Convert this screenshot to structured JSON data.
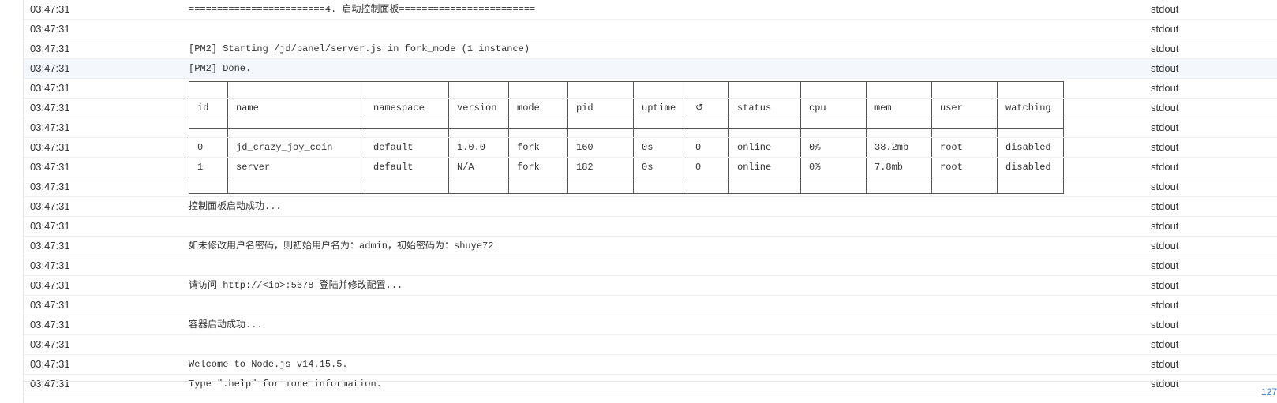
{
  "log": {
    "rows": [
      {
        "time": "03:47:31",
        "message": "========================4. 启动控制面板========================",
        "stream": "stdout"
      },
      {
        "time": "03:47:31",
        "message": "",
        "stream": "stdout"
      },
      {
        "time": "03:47:31",
        "message": "[PM2] Starting /jd/panel/server.js in fork_mode (1 instance)",
        "stream": "stdout"
      },
      {
        "time": "03:47:31",
        "message": "[PM2] Done.",
        "stream": "stdout"
      },
      {
        "time": "03:47:31",
        "kind": "border-top",
        "stream": "stdout"
      },
      {
        "time": "03:47:31",
        "kind": "header",
        "stream": "stdout"
      },
      {
        "time": "03:47:31",
        "kind": "border-mid",
        "stream": "stdout"
      },
      {
        "time": "03:47:31",
        "kind": "data",
        "cells": [
          "0",
          "jd_crazy_joy_coin",
          "default",
          "1.0.0",
          "fork",
          "160",
          "0s",
          "0",
          "online",
          "0%",
          "38.2mb",
          "root",
          "disabled"
        ],
        "stream": "stdout"
      },
      {
        "time": "03:47:31",
        "kind": "data",
        "cells": [
          "1",
          "server",
          "default",
          "N/A",
          "fork",
          "182",
          "0s",
          "0",
          "online",
          "0%",
          "7.8mb",
          "root",
          "disabled"
        ],
        "stream": "stdout"
      },
      {
        "time": "03:47:31",
        "kind": "border-bottom",
        "stream": "stdout"
      },
      {
        "time": "03:47:31",
        "message": "控制面板启动成功...",
        "stream": "stdout"
      },
      {
        "time": "03:47:31",
        "message": "",
        "stream": "stdout"
      },
      {
        "time": "03:47:31",
        "message": "如未修改用户名密码，则初始用户名为：admin，初始密码为：shuye72",
        "stream": "stdout"
      },
      {
        "time": "03:47:31",
        "message": "",
        "stream": "stdout"
      },
      {
        "time": "03:47:31",
        "message": "请访问 http://<ip>:5678 登陆并修改配置...",
        "stream": "stdout"
      },
      {
        "time": "03:47:31",
        "message": "",
        "stream": "stdout"
      },
      {
        "time": "03:47:31",
        "message": "容器启动成功...",
        "stream": "stdout"
      },
      {
        "time": "03:47:31",
        "message": "",
        "stream": "stdout"
      },
      {
        "time": "03:47:31",
        "message": "Welcome to Node.js v14.15.5.",
        "stream": "stdout"
      },
      {
        "time": "03:47:31",
        "message": "Type \".help\" for more information.",
        "stream": "stdout"
      }
    ],
    "highlighted_row": 3
  },
  "pm2_table": {
    "headers": [
      "id",
      "name",
      "namespace",
      "version",
      "mode",
      "pid",
      "uptime",
      "↺",
      "status",
      "cpu",
      "mem",
      "user",
      "watching"
    ]
  },
  "footer": {
    "count": "127"
  }
}
